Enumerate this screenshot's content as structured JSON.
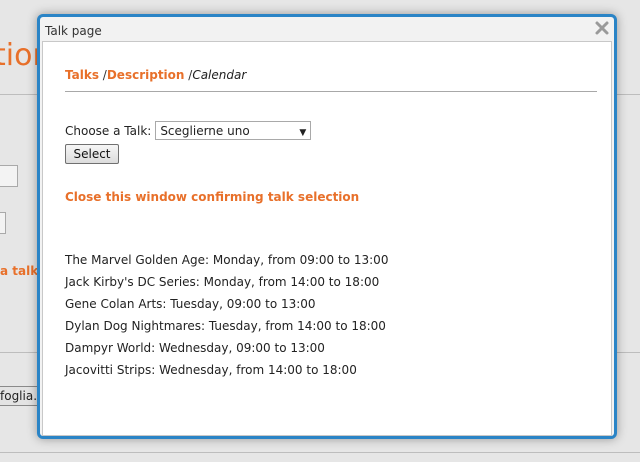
{
  "background": {
    "title_fragment": "tion",
    "link_fragment": "a talk",
    "button_fragment": "foglia.."
  },
  "dialog": {
    "title": "Talk page",
    "close_icon": "close-x-icon",
    "tabs": {
      "talks": "Talks",
      "sep1": " /",
      "description": "Description",
      "sep2": " /",
      "calendar": "Calendar"
    },
    "choose_label": "Choose a Talk:",
    "select_value": "Sceglierne uno",
    "select_button": "Select",
    "confirm_link": "Close this window confirming talk selection",
    "talks": [
      "The Marvel Golden Age: Monday, from 09:00 to 13:00",
      "Jack Kirby's DC Series: Monday, from 14:00 to 18:00",
      "Gene Colan Arts: Tuesday, 09:00 to 13:00",
      "Dylan Dog Nightmares: Tuesday, from 14:00 to 18:00",
      "Dampyr World: Wednesday, 09:00 to 13:00",
      "Jacovitti Strips: Wednesday, from 14:00 to 18:00"
    ]
  },
  "colors": {
    "accent": "#e8702a",
    "dialog_border": "#2a84c6"
  }
}
